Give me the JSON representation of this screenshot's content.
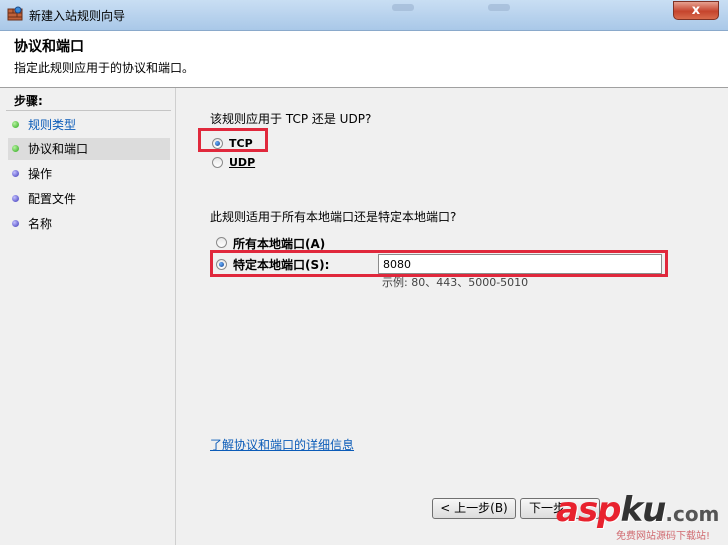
{
  "window": {
    "title": "新建入站规则向导",
    "close_label": "x"
  },
  "header": {
    "title": "协议和端口",
    "subtitle": "指定此规则应用于的协议和端口。"
  },
  "steps": {
    "label": "步骤:",
    "items": [
      {
        "label": "规则类型",
        "status": "done"
      },
      {
        "label": "协议和端口",
        "status": "current"
      },
      {
        "label": "操作",
        "status": "pending"
      },
      {
        "label": "配置文件",
        "status": "pending"
      },
      {
        "label": "名称",
        "status": "pending"
      }
    ]
  },
  "protocol": {
    "question": "该规则应用于 TCP 还是 UDP?",
    "options": [
      {
        "label": "TCP",
        "selected": true
      },
      {
        "label": "UDP",
        "selected": false
      }
    ]
  },
  "ports": {
    "question": "此规则适用于所有本地端口还是特定本地端口?",
    "all_label": "所有本地端口(A)",
    "specific_label": "特定本地端口(S):",
    "selected": "specific",
    "value": "8080",
    "example": "示例: 80、443、5000-5010"
  },
  "more_info_link": "了解协议和端口的详细信息",
  "buttons": {
    "back": "< 上一步(B)",
    "next": "下一步"
  },
  "watermark": {
    "main": "asp",
    "main2": "ku",
    "domain": ".com",
    "sub": "免费网站源码下载站!"
  },
  "colors": {
    "highlight": "#e0283c",
    "link": "#0a5bb8",
    "done_dot": "#2ba81a",
    "pending_dot": "#3b36b8"
  }
}
